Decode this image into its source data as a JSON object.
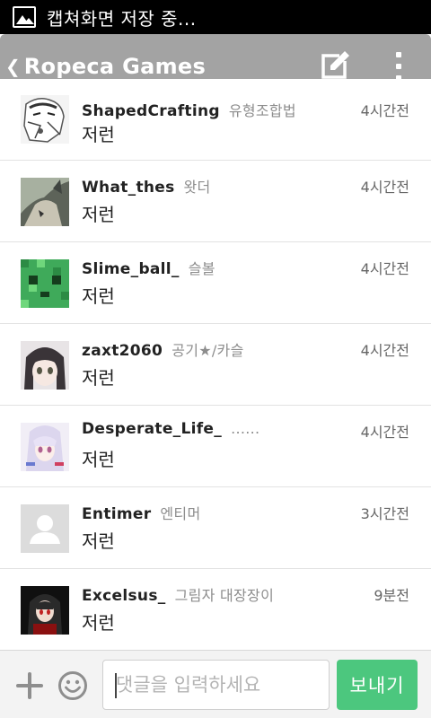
{
  "status_bar": {
    "text": "캡쳐화면 저장 중..."
  },
  "app_bar": {
    "title": "Ropeca Games",
    "back_glyph": "❮"
  },
  "comments": [
    {
      "username": "ShapedCrafting",
      "nickname": "유형조합법",
      "time": "4시간전",
      "message": "저런",
      "avatar": "manga-character"
    },
    {
      "username": "What_thes",
      "nickname": "왓더",
      "time": "4시간전",
      "message": "저런",
      "avatar": "wolf"
    },
    {
      "username": "Slime_ball_",
      "nickname": "슬볼",
      "time": "4시간전",
      "message": "저런",
      "avatar": "minecraft-slime"
    },
    {
      "username": "zaxt2060",
      "nickname": "공기★/카슬",
      "time": "4시간전",
      "message": "저런",
      "avatar": "anime-girl-dark-hair"
    },
    {
      "username": "Desperate_Life_",
      "nickname": "......",
      "time": "4시간전",
      "message": "저런",
      "avatar": "anime-girl-white-hair"
    },
    {
      "username": "Entimer",
      "nickname": "엔티머",
      "time": "3시간전",
      "message": "저런",
      "avatar": "default-user"
    },
    {
      "username": "Excelsus_",
      "nickname": "그림자 대장장이",
      "time": "9분전",
      "message": "저런",
      "avatar": "hooded-figure"
    }
  ],
  "input": {
    "placeholder": "댓글을 입력하세요"
  },
  "send_label": "보내기",
  "colors": {
    "app_bar": "#a3a3a3",
    "send_button": "#4cc77e",
    "status_bar": "#000000"
  }
}
